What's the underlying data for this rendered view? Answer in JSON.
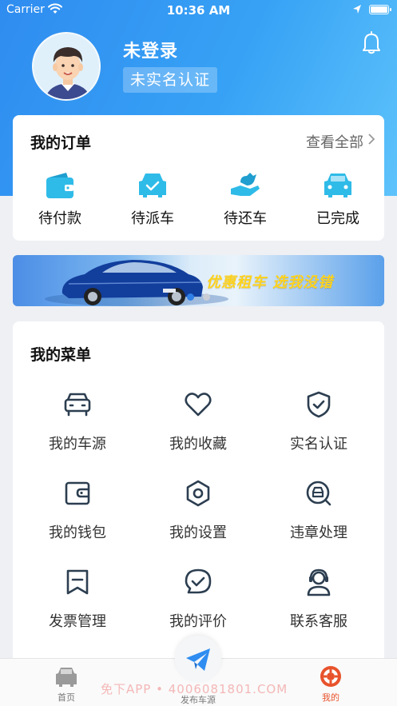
{
  "status_bar": {
    "carrier": "Carrier",
    "time": "10:36 AM"
  },
  "profile": {
    "username": "未登录",
    "auth_status": "未实名认证"
  },
  "orders": {
    "title": "我的订单",
    "view_all": "查看全部",
    "items": [
      {
        "label": "待付款",
        "icon": "wallet-icon"
      },
      {
        "label": "待派车",
        "icon": "car-check-icon"
      },
      {
        "label": "待还车",
        "icon": "hand-return-icon"
      },
      {
        "label": "已完成",
        "icon": "car-done-icon"
      }
    ]
  },
  "banner": {
    "text": "优惠租车  选我没错",
    "pages": 2,
    "active_page": 1
  },
  "menu": {
    "title": "我的菜单",
    "items": [
      {
        "label": "我的车源",
        "icon": "car-icon"
      },
      {
        "label": "我的收藏",
        "icon": "heart-icon"
      },
      {
        "label": "实名认证",
        "icon": "shield-check-icon"
      },
      {
        "label": "我的钱包",
        "icon": "wallet-outline-icon"
      },
      {
        "label": "我的设置",
        "icon": "hex-settings-icon"
      },
      {
        "label": "违章处理",
        "icon": "search-car-icon"
      },
      {
        "label": "发票管理",
        "icon": "invoice-icon"
      },
      {
        "label": "我的评价",
        "icon": "comment-check-icon"
      },
      {
        "label": "联系客服",
        "icon": "headset-icon"
      }
    ]
  },
  "tabbar": {
    "home": "首页",
    "publish": "发布车源",
    "mine": "我的",
    "active": "mine"
  },
  "watermark": "免下APP • 4006081801.COM",
  "colors": {
    "header_gradient_start": "#2f8cf0",
    "header_gradient_end": "#5ec3fb",
    "order_icon": "#27b6e6",
    "menu_icon": "#2c3e50",
    "active_tab": "#e8532c",
    "banner_text": "#ffd21a"
  }
}
